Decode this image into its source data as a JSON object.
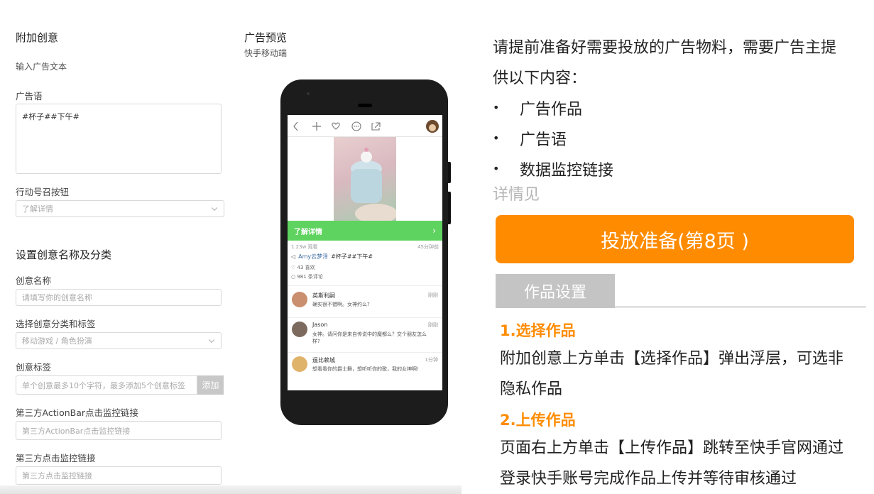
{
  "form": {
    "extra_title": "附加创意",
    "ad_text_label": "输入广告文本",
    "slogan_label": "广告语",
    "slogan_value": "#杯子##下午#",
    "cta_label": "行动号召按钮",
    "cta_value": "了解详情",
    "naming_section": "设置创意名称及分类",
    "name_label": "创意名称",
    "name_placeholder": "请填写你的创意名称",
    "category_label": "选择创意分类和标签",
    "category_value": "移动游戏 / 角色扮演",
    "tags_label": "创意标签",
    "tags_placeholder": "单个创意最多10个字符，最多添加5个创意标签",
    "tags_add": "添加",
    "actionbar_label": "第三方ActionBar点击监控链接",
    "actionbar_placeholder": "第三方ActionBar点击监控链接",
    "click_label": "第三方点击监控链接",
    "click_placeholder": "第三方点击监控链接"
  },
  "preview": {
    "title": "广告预览",
    "subtitle": "快手移动端",
    "cta_bar": "了解详情",
    "stats_left": "1.23w 观看",
    "stats_right": "45分钟前",
    "author": "Amy云梦泽",
    "caption": "#杯子##下午#",
    "likes": "43 喜欢",
    "comments_count": "981 条评论",
    "comments": [
      {
        "name": "英斯利嗣",
        "time": "刚刚",
        "text": "确实很不错啊。女神约么?"
      },
      {
        "name": "Jason",
        "time": "刚刚",
        "text": "女神。请问你是来自传说中的魔都么？交个朋友怎么样?"
      },
      {
        "name": "遥比赖城",
        "time": "1分钟",
        "text": "想看看你的爵士舞，想听听你的歌，我的女神啊!"
      }
    ]
  },
  "guide": {
    "intro": "请提前准备好需要投放的广告物料，需要广告主提供以下内容：",
    "intro_line1": "请提前准备好需要投放的广告物料，需要广告主提",
    "intro_line2": "供以下内容：",
    "bullets": [
      "广告作品",
      "广告语",
      "数据监控链接"
    ],
    "details": "详情见",
    "button": "投放准备(第8页 )",
    "tab": "作品设置",
    "step1_title": "1.选择作品",
    "step1_line1": "附加创意上方单击【选择作品】弹出浮层，可选非",
    "step1_line2": "隐私作品",
    "step2_title": "2.上传作品",
    "step2_line1": "页面右上方单击【上传作品】跳转至快手官网通过",
    "step2_line2": "登录快手账号完成作品上传并等待审核通过"
  },
  "colors": {
    "accent_orange": "#ff8c00",
    "cta_green": "#5fd35f",
    "tab_gray": "#c4c4c4"
  }
}
